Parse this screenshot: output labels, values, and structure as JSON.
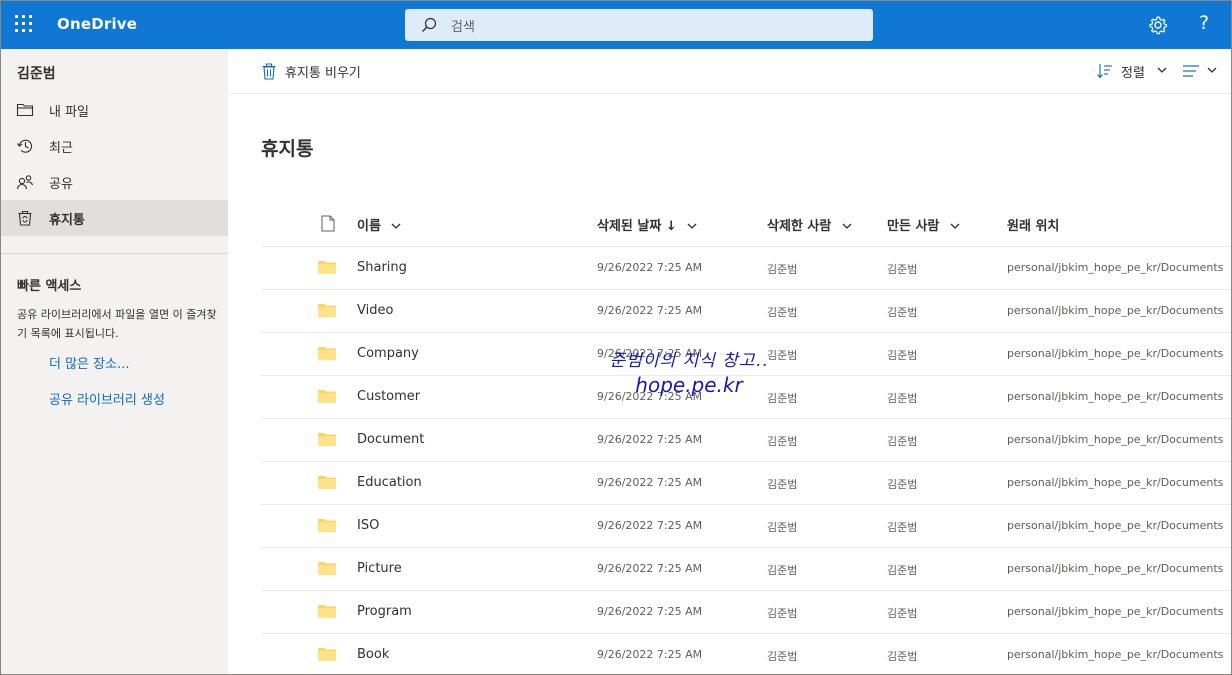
{
  "app": {
    "brand": "OneDrive",
    "search_placeholder": "검색",
    "help": "?"
  },
  "colors": {
    "topbar": "#0f78d4",
    "accent_link": "#0f6cbd",
    "folder": "#ffd35c"
  },
  "sidebar": {
    "user": "김준범",
    "items": [
      {
        "label": "내 파일",
        "icon": "folder-icon",
        "active": false
      },
      {
        "label": "최근",
        "icon": "history-icon",
        "active": false
      },
      {
        "label": "공유",
        "icon": "people-icon",
        "active": false
      },
      {
        "label": "휴지통",
        "icon": "recycle-bin-icon",
        "active": true
      }
    ],
    "quick_access": {
      "title": "빠른 액세스",
      "description": "공유 라이브러리에서 파일을 열면 이 즐겨찾기 목록에 표시됩니다.",
      "more_link": "더 많은 장소...",
      "create_link": "공유 라이브러리 생성"
    }
  },
  "command_bar": {
    "empty_label": "휴지통 비우기",
    "sort_label": "정렬"
  },
  "main": {
    "title": "휴지통",
    "columns": {
      "name": "이름",
      "deleted_date": "삭제된 날짜 ↓",
      "deleted_by": "삭제한 사람",
      "created_by": "만든 사람",
      "original_location": "원래 위치"
    },
    "rows": [
      {
        "name": "Sharing",
        "date": "9/26/2022 7:25 AM",
        "deleted_by": "김준범",
        "created_by": "김준범",
        "location": "personal/jbkim_hope_pe_kr/Documents"
      },
      {
        "name": "Video",
        "date": "9/26/2022 7:25 AM",
        "deleted_by": "김준범",
        "created_by": "김준범",
        "location": "personal/jbkim_hope_pe_kr/Documents"
      },
      {
        "name": "Company",
        "date": "9/26/2022 7:25 AM",
        "deleted_by": "김준범",
        "created_by": "김준범",
        "location": "personal/jbkim_hope_pe_kr/Documents"
      },
      {
        "name": "Customer",
        "date": "9/26/2022 7:25 AM",
        "deleted_by": "김준범",
        "created_by": "김준범",
        "location": "personal/jbkim_hope_pe_kr/Documents"
      },
      {
        "name": "Document",
        "date": "9/26/2022 7:25 AM",
        "deleted_by": "김준범",
        "created_by": "김준범",
        "location": "personal/jbkim_hope_pe_kr/Documents"
      },
      {
        "name": "Education",
        "date": "9/26/2022 7:25 AM",
        "deleted_by": "김준범",
        "created_by": "김준범",
        "location": "personal/jbkim_hope_pe_kr/Documents"
      },
      {
        "name": "ISO",
        "date": "9/26/2022 7:25 AM",
        "deleted_by": "김준범",
        "created_by": "김준범",
        "location": "personal/jbkim_hope_pe_kr/Documents"
      },
      {
        "name": "Picture",
        "date": "9/26/2022 7:25 AM",
        "deleted_by": "김준범",
        "created_by": "김준범",
        "location": "personal/jbkim_hope_pe_kr/Documents"
      },
      {
        "name": "Program",
        "date": "9/26/2022 7:25 AM",
        "deleted_by": "김준범",
        "created_by": "김준범",
        "location": "personal/jbkim_hope_pe_kr/Documents"
      },
      {
        "name": "Book",
        "date": "9/26/2022 7:25 AM",
        "deleted_by": "김준범",
        "created_by": "김준범",
        "location": "personal/jbkim_hope_pe_kr/Documents"
      }
    ]
  },
  "watermark": {
    "line1": "준범이의 지식 창고..",
    "line2": "hope.pe.kr"
  }
}
